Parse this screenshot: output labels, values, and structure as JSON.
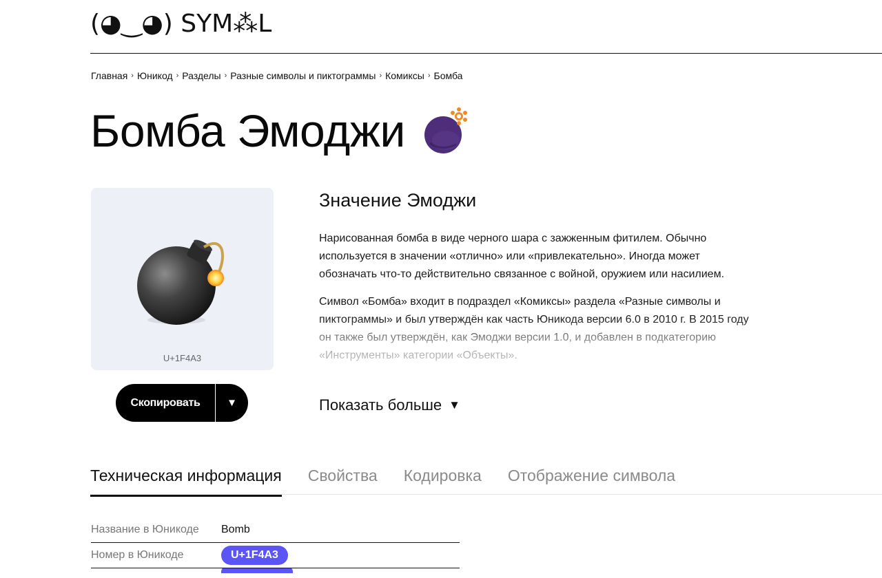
{
  "header": {
    "logo_text": "(◕‿◕) SYM⁂L"
  },
  "breadcrumb": [
    "Главная",
    "Юникод",
    "Разделы",
    "Разные символы и пиктограммы",
    "Комиксы",
    "Бомба"
  ],
  "breadcrumb_separator": "›",
  "title": "Бомба Эмоджи",
  "preview": {
    "code": "U+1F4A3"
  },
  "copy_button": {
    "label": "Скопировать",
    "caret": "▼"
  },
  "meaning": {
    "heading": "Значение Эмоджи",
    "paragraph_1": "Нарисованная бомба в виде черного шара с зажженным фитилем. Обычно используется в значении «отлично» или «привлекательно». Иногда может обозначать что-то действительно связанное с войной, оружием или насилием.",
    "paragraph_2": "Символ «Бомба» входит в подраздел «Комиксы» раздела «Разные символы и пиктограммы» и был утверждён как часть Юникода версии 6.0 в 2010 г. В 2015 году он также был утверждён, как Эмоджи версии 1.0, и добавлен в подкатегорию «Инструменты» категории «Объекты».",
    "show_more": "Показать больше",
    "show_more_arrow": "▼"
  },
  "tabs": [
    {
      "label": "Техническая информация",
      "active": true
    },
    {
      "label": "Свойства",
      "active": false
    },
    {
      "label": "Кодировка",
      "active": false
    },
    {
      "label": "Отображение символа",
      "active": false
    }
  ],
  "info": {
    "rows": [
      {
        "key": "Название в Юникоде",
        "value": "Bomb"
      },
      {
        "key": "Номер в Юникоде",
        "value": "U+1F4A3"
      }
    ]
  },
  "colors": {
    "accent": "#5b55f5",
    "preview_bg": "#eef0f7",
    "title_bomb": "#4e2d7a",
    "spark": "#f08a24"
  }
}
